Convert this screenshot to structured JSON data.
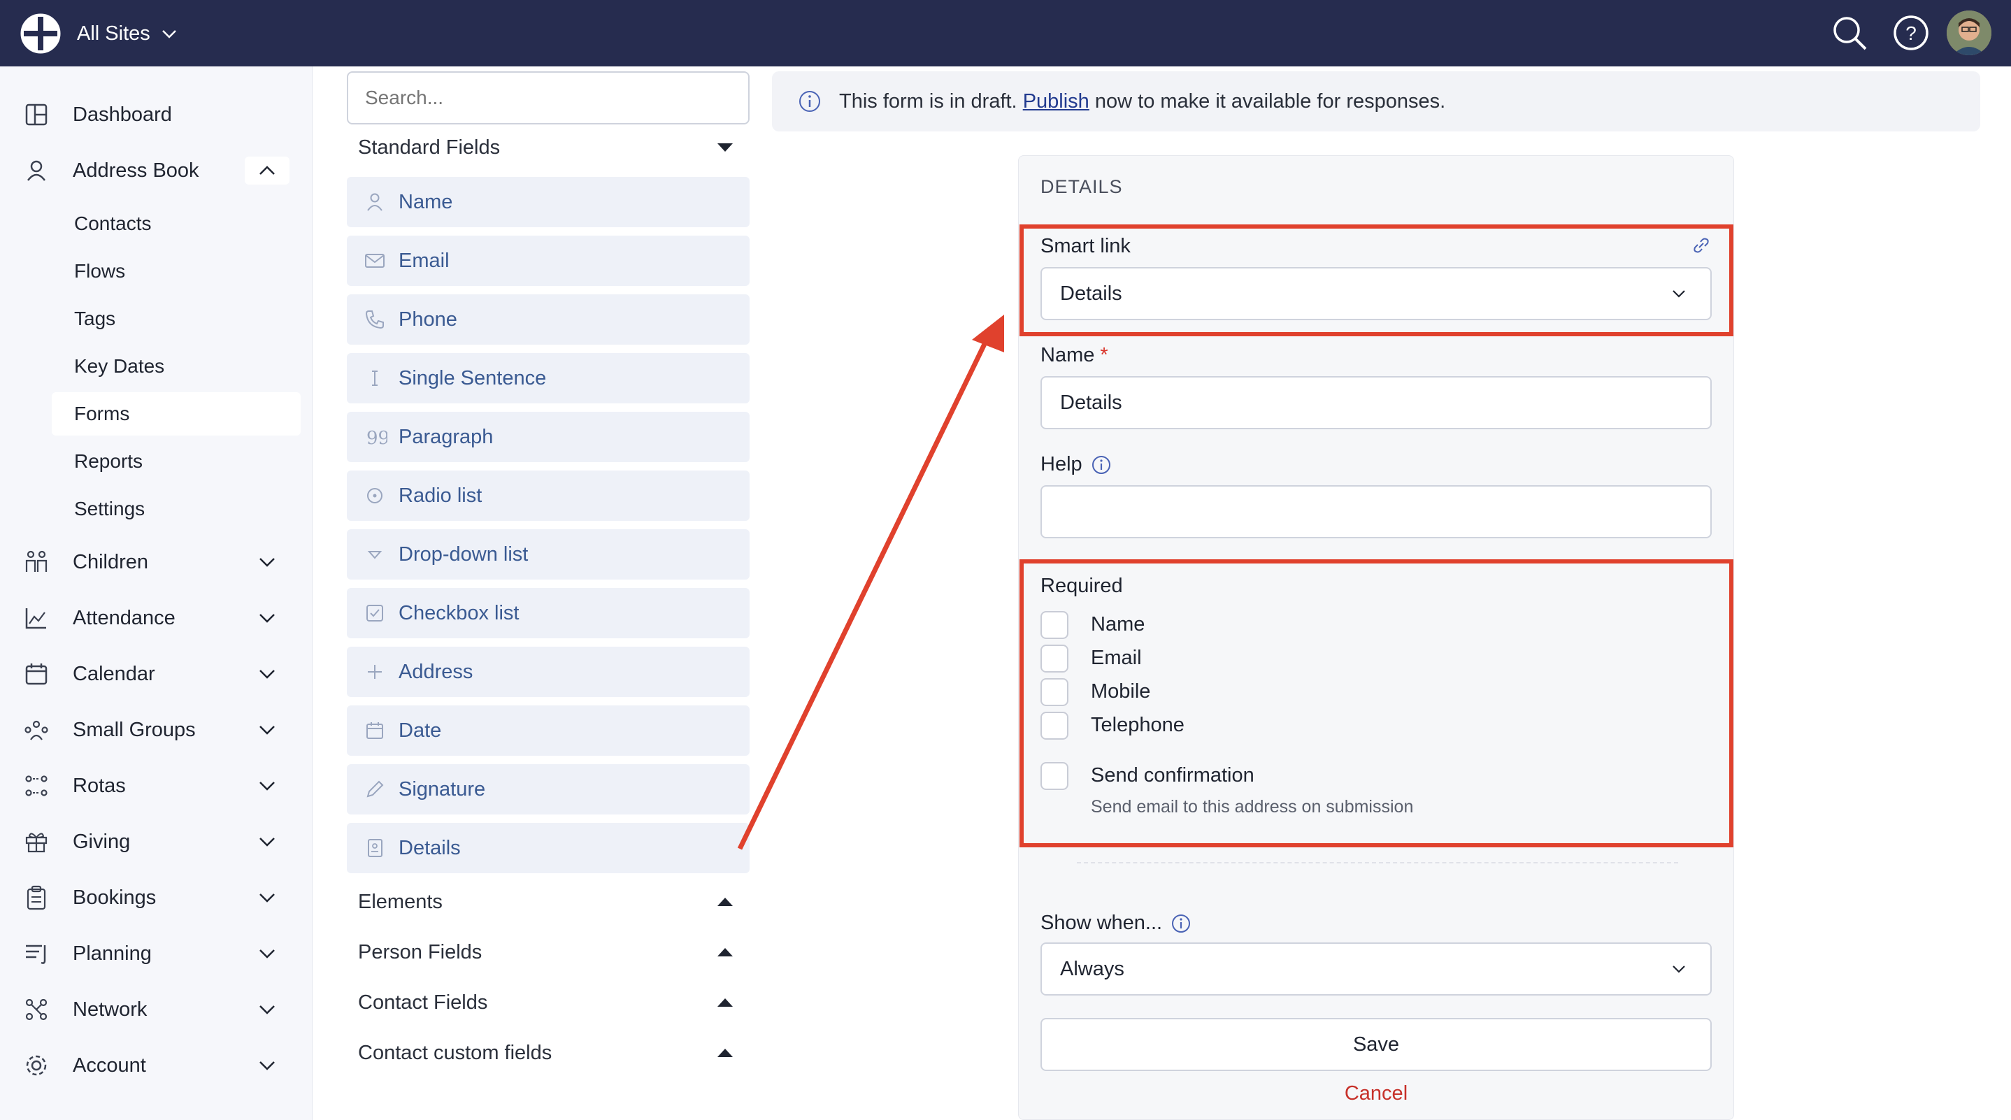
{
  "topbar": {
    "site_label": "All Sites",
    "icons": [
      "globe-logo-icon",
      "chevron-down-icon",
      "search-icon",
      "help-icon",
      "avatar"
    ]
  },
  "sidebar": {
    "items": [
      {
        "label": "Dashboard",
        "icon": "dashboard-icon"
      },
      {
        "label": "Address Book",
        "icon": "person-icon",
        "expanded": true
      },
      {
        "label": "Children",
        "icon": "children-icon"
      },
      {
        "label": "Attendance",
        "icon": "chart-icon"
      },
      {
        "label": "Calendar",
        "icon": "calendar-icon"
      },
      {
        "label": "Small Groups",
        "icon": "groups-icon"
      },
      {
        "label": "Rotas",
        "icon": "rotas-icon"
      },
      {
        "label": "Giving",
        "icon": "gift-icon"
      },
      {
        "label": "Bookings",
        "icon": "clipboard-icon"
      },
      {
        "label": "Planning",
        "icon": "planning-icon"
      },
      {
        "label": "Network",
        "icon": "network-icon"
      },
      {
        "label": "Account",
        "icon": "gear-icon"
      }
    ],
    "sub_items": [
      "Contacts",
      "Flows",
      "Tags",
      "Key Dates",
      "Forms",
      "Reports",
      "Settings"
    ],
    "active_sub": "Forms"
  },
  "palette": {
    "search_placeholder": "Search...",
    "standard_label": "Standard Fields",
    "fields": [
      "Name",
      "Email",
      "Phone",
      "Single Sentence",
      "Paragraph",
      "Radio list",
      "Drop-down list",
      "Checkbox list",
      "Address",
      "Date",
      "Signature",
      "Details"
    ],
    "groups": [
      "Elements",
      "Person Fields",
      "Contact Fields",
      "Contact custom fields"
    ]
  },
  "banner": {
    "text_before": "This form is in draft.",
    "link": "Publish",
    "text_after": "now to make it available for responses."
  },
  "details": {
    "title": "DETAILS",
    "smart_link_label": "Smart link",
    "smart_link_value": "Details",
    "name_label": "Name",
    "name_required": "*",
    "name_value": "Details",
    "help_label": "Help",
    "help_value": "",
    "required_label": "Required",
    "required_options": [
      "Name",
      "Email",
      "Mobile",
      "Telephone"
    ],
    "send_confirmation_label": "Send confirmation",
    "send_confirmation_hint": "Send email to this address on submission",
    "show_when_label": "Show when...",
    "show_when_value": "Always",
    "save_label": "Save",
    "cancel_label": "Cancel"
  },
  "colors": {
    "topbar": "#262c4f",
    "highlight": "#e0412d",
    "field_text": "#3a5a92",
    "cancel": "#c7312a"
  }
}
